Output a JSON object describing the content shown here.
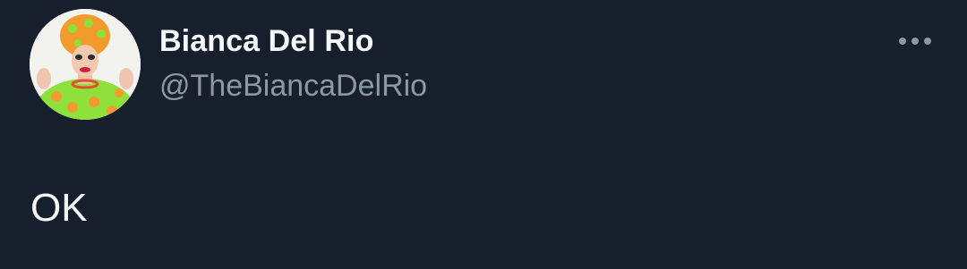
{
  "tweet": {
    "author": {
      "display_name": "Bianca Del Rio",
      "handle": "@TheBiancaDelRio",
      "avatar_icon": "profile-avatar"
    },
    "more_icon": "more-horizontal-icon",
    "text": "OK"
  },
  "colors": {
    "background": "#161f2b",
    "primary_text": "#f5f8fa",
    "secondary_text": "#8b98a5"
  }
}
